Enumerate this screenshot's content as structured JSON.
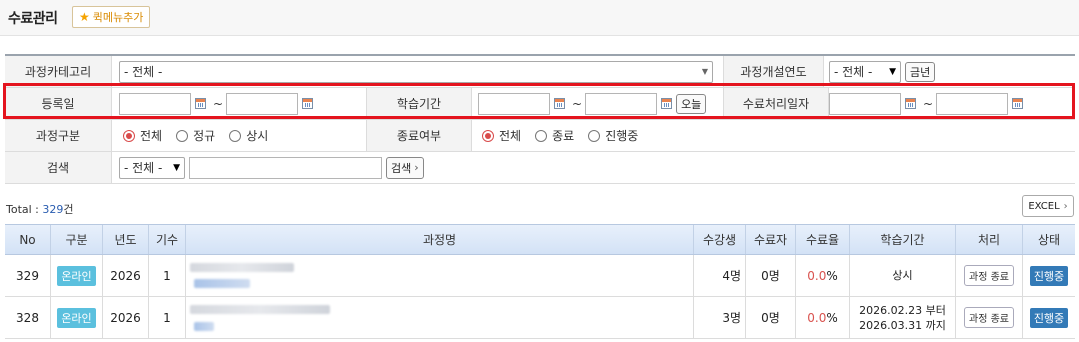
{
  "page": {
    "title": "수료관리",
    "quick_menu_label": "퀵메뉴추가",
    "quick_menu_icon": "star-icon"
  },
  "filter": {
    "category": {
      "label": "과정카테고리",
      "value": "- 전체 -"
    },
    "open_year": {
      "label": "과정개설연도",
      "value": "- 전체 -",
      "this_year_label": "금년"
    },
    "reg_date": {
      "label": "등록일",
      "from": "",
      "to": "",
      "separator": "~"
    },
    "study_period": {
      "label": "학습기간",
      "from": "",
      "to": "",
      "separator": "~",
      "today_label": "오늘"
    },
    "complete_date": {
      "label": "수료처리일자",
      "from": "",
      "to": "",
      "separator": "~"
    },
    "course_type": {
      "label": "과정구분",
      "options": [
        "전체",
        "정규",
        "상시"
      ],
      "selected": "전체"
    },
    "end_status": {
      "label": "종료여부",
      "options": [
        "전체",
        "종료",
        "진행중"
      ],
      "selected": "전체"
    },
    "search": {
      "label": "검색",
      "scope": "- 전체 -",
      "keyword": "",
      "button_label": "검색",
      "button_arrow": "›"
    },
    "highlight_color": "#e4141e"
  },
  "summary": {
    "total_prefix": "Total : ",
    "total_count": "329",
    "total_suffix": "건",
    "excel_label": "EXCEL",
    "excel_arrow": "›"
  },
  "table": {
    "headers": [
      "No",
      "구분",
      "년도",
      "기수",
      "과정명",
      "수강생",
      "수료자",
      "수료율",
      "학습기간",
      "처리",
      "상태"
    ],
    "rows": [
      {
        "no": "329",
        "type": "온라인",
        "year": "2026",
        "term": "1",
        "students": "4명",
        "completers": "0명",
        "rate": "0.0",
        "rate_unit": "%",
        "period_line1": "상시",
        "period_line2": "",
        "action": "과정 종료",
        "status": "진행중"
      },
      {
        "no": "328",
        "type": "온라인",
        "year": "2026",
        "term": "1",
        "students": "3명",
        "completers": "0명",
        "rate": "0.0",
        "rate_unit": "%",
        "period_line1": "2026.02.23 부터",
        "period_line2": "2026.03.31 까지",
        "action": "과정 종료",
        "status": "진행중"
      }
    ]
  },
  "colors": {
    "accent_badge": "#5bc0de",
    "status_badge": "#337ab7",
    "rate_color": "#d9534f"
  }
}
